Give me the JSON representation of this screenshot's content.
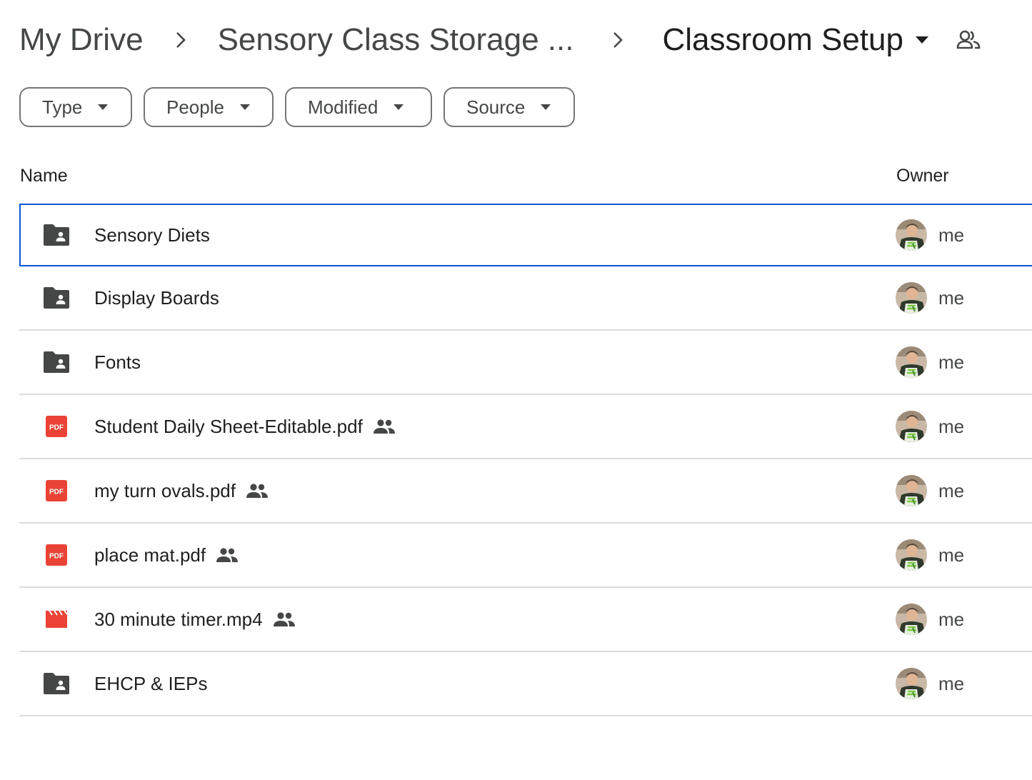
{
  "breadcrumb": {
    "root": "My Drive",
    "parent": "Sensory Class Storage ...",
    "current": "Classroom Setup"
  },
  "filters": [
    {
      "label": "Type"
    },
    {
      "label": "People"
    },
    {
      "label": "Modified"
    },
    {
      "label": "Source"
    }
  ],
  "columns": {
    "name": "Name",
    "owner": "Owner"
  },
  "files": [
    {
      "name": "Sensory Diets",
      "kind": "shared-folder-icon",
      "shared": false,
      "owner": "me"
    },
    {
      "name": "Display Boards",
      "kind": "shared-folder-icon",
      "shared": false,
      "owner": "me"
    },
    {
      "name": "Fonts",
      "kind": "shared-folder-icon",
      "shared": false,
      "owner": "me"
    },
    {
      "name": "Student Daily Sheet-Editable.pdf",
      "kind": "pdf-icon",
      "shared": true,
      "owner": "me"
    },
    {
      "name": "my turn ovals.pdf",
      "kind": "pdf-icon",
      "shared": true,
      "owner": "me"
    },
    {
      "name": "place mat.pdf",
      "kind": "pdf-icon",
      "shared": true,
      "owner": "me"
    },
    {
      "name": "30 minute timer.mp4",
      "kind": "video-icon",
      "shared": true,
      "owner": "me"
    },
    {
      "name": "EHCP & IEPs",
      "kind": "shared-folder-icon",
      "shared": false,
      "owner": "me"
    }
  ],
  "pdf_badge": "PDF",
  "colors": {
    "selection_border": "#0b57d0",
    "pdf_red": "#ea4335",
    "folder_dark": "#444746"
  }
}
